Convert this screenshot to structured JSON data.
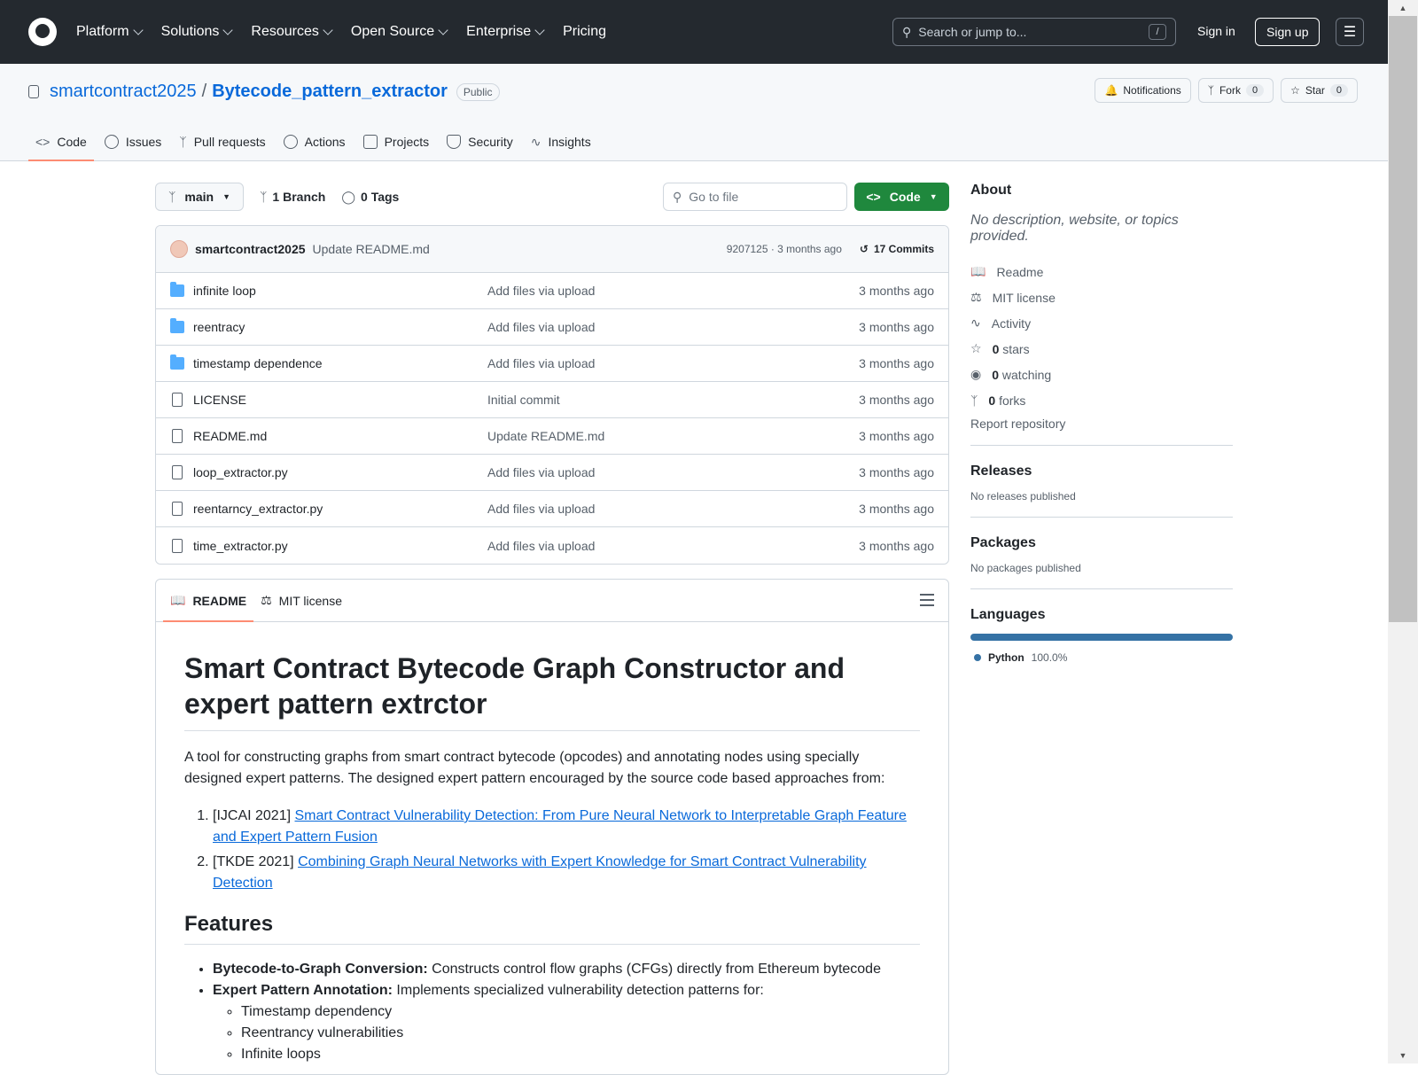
{
  "header": {
    "nav": [
      "Platform",
      "Solutions",
      "Resources",
      "Open Source",
      "Enterprise",
      "Pricing"
    ],
    "search_placeholder": "Search or jump to...",
    "search_shortcut": "/",
    "sign_in": "Sign in",
    "sign_up": "Sign up"
  },
  "repo": {
    "owner": "smartcontract2025",
    "separator": "/",
    "name": "Bytecode_pattern_extractor",
    "visibility": "Public",
    "notifications": "Notifications",
    "fork": "Fork",
    "fork_count": "0",
    "star": "Star",
    "star_count": "0",
    "tabs": [
      "Code",
      "Issues",
      "Pull requests",
      "Actions",
      "Projects",
      "Security",
      "Insights"
    ]
  },
  "toolbar": {
    "branch": "main",
    "branches": "1 Branch",
    "tags": "0 Tags",
    "gofile_placeholder": "Go to file",
    "code_button": "Code"
  },
  "commit": {
    "author": "smartcontract2025",
    "message": "Update README.md",
    "sha_time": "9207125 · 3 months ago",
    "commits": "17 Commits"
  },
  "files": [
    {
      "type": "folder",
      "name": "infinite loop",
      "message": "Add files via upload",
      "time": "3 months ago"
    },
    {
      "type": "folder",
      "name": "reentracy",
      "message": "Add files via upload",
      "time": "3 months ago"
    },
    {
      "type": "folder",
      "name": "timestamp dependence",
      "message": "Add files via upload",
      "time": "3 months ago"
    },
    {
      "type": "file",
      "name": "LICENSE",
      "message": "Initial commit",
      "time": "3 months ago"
    },
    {
      "type": "file",
      "name": "README.md",
      "message": "Update README.md",
      "time": "3 months ago"
    },
    {
      "type": "file",
      "name": "loop_extractor.py",
      "message": "Add files via upload",
      "time": "3 months ago"
    },
    {
      "type": "file",
      "name": "reentarncy_extractor.py",
      "message": "Add files via upload",
      "time": "3 months ago"
    },
    {
      "type": "file",
      "name": "time_extractor.py",
      "message": "Add files via upload",
      "time": "3 months ago"
    }
  ],
  "readme": {
    "tab_readme": "README",
    "tab_license": "MIT license",
    "title": "Smart Contract Bytecode Graph Constructor and expert pattern extrctor",
    "intro": "A tool for constructing graphs from smart contract bytecode (opcodes) and annotating nodes using specially designed expert patterns. The designed expert pattern encouraged by the source code based approaches from:",
    "refs": [
      {
        "venue": "[IJCAI 2021]",
        "title": "Smart Contract Vulnerability Detection: From Pure Neural Network to Interpretable Graph Feature and Expert Pattern Fusion"
      },
      {
        "venue": "[TKDE 2021]",
        "title": "Combining Graph Neural Networks with Expert Knowledge for Smart Contract Vulnerability Detection"
      }
    ],
    "features_heading": "Features",
    "feature1_bold": "Bytecode-to-Graph Conversion:",
    "feature1_text": " Constructs control flow graphs (CFGs) directly from Ethereum bytecode",
    "feature2_bold": "Expert Pattern Annotation:",
    "feature2_text": " Implements specialized vulnerability detection patterns for:",
    "subfeatures": [
      "Timestamp dependency",
      "Reentrancy vulnerabilities",
      "Infinite loops"
    ]
  },
  "sidebar": {
    "about": "About",
    "description": "No description, website, or topics provided.",
    "readme": "Readme",
    "license": "MIT license",
    "activity": "Activity",
    "stars_count": "0",
    "stars_label": "stars",
    "watching_count": "0",
    "watching_label": "watching",
    "forks_count": "0",
    "forks_label": "forks",
    "report": "Report repository",
    "releases": "Releases",
    "no_releases": "No releases published",
    "packages": "Packages",
    "no_packages": "No packages published",
    "languages": "Languages",
    "lang_name": "Python",
    "lang_pct": "100.0%"
  },
  "colors": {
    "accent": "#0969da",
    "code_button": "#1f883d",
    "python": "#3572a5",
    "tab_underline": "#fd8c73"
  }
}
